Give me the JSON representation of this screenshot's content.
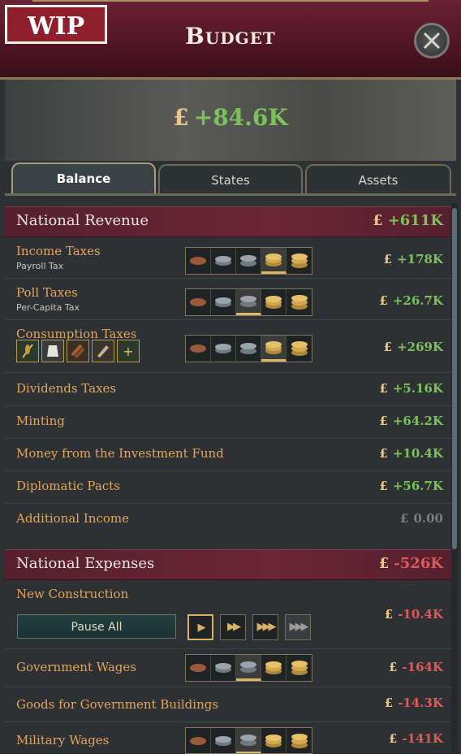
{
  "window": {
    "title": "Budget",
    "wip_badge": "WIP"
  },
  "summary": {
    "currency": "£",
    "total": "+84.6K"
  },
  "tabs": [
    {
      "label": "Balance"
    },
    {
      "label": "States"
    },
    {
      "label": "Assets"
    }
  ],
  "revenue": {
    "title": "National Revenue",
    "total": "+611K",
    "rows": [
      {
        "name": "Income Taxes",
        "sub": "Payroll Tax",
        "amount": "+178K",
        "level": 4
      },
      {
        "name": "Poll Taxes",
        "sub": "Per-Capita Tax",
        "amount": "+26.7K",
        "level": 3
      },
      {
        "name": "Consumption Taxes",
        "amount": "+269K",
        "level": 4
      },
      {
        "name": "Dividends Taxes",
        "amount": "+5.16K"
      },
      {
        "name": "Minting",
        "amount": "+64.2K"
      },
      {
        "name": "Money from the Investment Fund",
        "amount": "+10.4K"
      },
      {
        "name": "Diplomatic Pacts",
        "amount": "+56.7K"
      },
      {
        "name": "Additional Income",
        "amount": "0.00"
      }
    ],
    "consumption_goods": [
      "grain-icon",
      "clothes-icon",
      "wood-icon",
      "paper-icon",
      "add-icon"
    ],
    "add_symbol": "+"
  },
  "expenses": {
    "title": "National Expenses",
    "total": "-526K",
    "rows": [
      {
        "name": "New Construction",
        "amount": "-10.4K"
      },
      {
        "name": "Government Wages",
        "amount": "-164K",
        "level": 3
      },
      {
        "name": "Goods for Government Buildings",
        "amount": "-14.3K"
      },
      {
        "name": "Military Wages",
        "amount": "-141K",
        "level": 3
      }
    ],
    "pause_label": "Pause All",
    "speeds": [
      "▶",
      "▶▶",
      "▶▶▶",
      "▶▶▶"
    ]
  },
  "colors": {
    "positive": "#7cc25a",
    "negative": "#e05a55",
    "label": "#e3a55a",
    "header": "#6a2536"
  }
}
